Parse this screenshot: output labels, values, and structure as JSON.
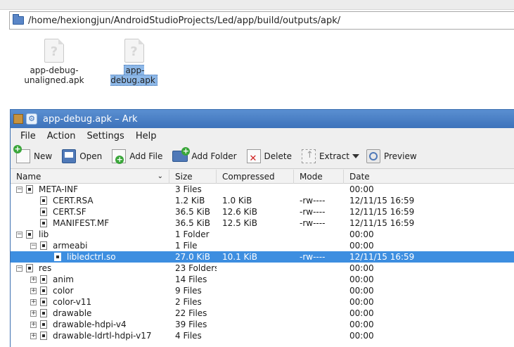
{
  "location": {
    "path": "/home/hexiongjun/AndroidStudioProjects/Led/app/build/outputs/apk/"
  },
  "files": [
    {
      "label": "app-debug-\nunaligned.apk",
      "line1": "app-debug-",
      "line2": "unaligned.apk",
      "selected": false,
      "icon": "unknown-file-icon"
    },
    {
      "label": "app-debug.apk",
      "selected": true,
      "icon": "unknown-file-icon"
    }
  ],
  "ark": {
    "title": "app-debug.apk – Ark",
    "menu": [
      "File",
      "Action",
      "Settings",
      "Help"
    ],
    "toolbar": {
      "new": "New",
      "open": "Open",
      "add_file": "Add File",
      "add_folder": "Add Folder",
      "delete": "Delete",
      "extract": "Extract",
      "preview": "Preview"
    },
    "columns": {
      "name": "Name",
      "size": "Size",
      "compressed": "Compressed",
      "mode": "Mode",
      "date": "Date"
    },
    "rows": [
      {
        "name": "META-INF",
        "size": "3 Files",
        "compressed": "",
        "mode": "",
        "date": "00:00",
        "depth": 0,
        "expander": "−",
        "selected": false
      },
      {
        "name": "CERT.RSA",
        "size": "1.2 KiB",
        "compressed": "1.0 KiB",
        "mode": "-rw----",
        "date": "12/11/15 16:59",
        "depth": 1,
        "expander": "",
        "selected": false
      },
      {
        "name": "CERT.SF",
        "size": "36.5 KiB",
        "compressed": "12.6 KiB",
        "mode": "-rw----",
        "date": "12/11/15 16:59",
        "depth": 1,
        "expander": "",
        "selected": false
      },
      {
        "name": "MANIFEST.MF",
        "size": "36.5 KiB",
        "compressed": "12.5 KiB",
        "mode": "-rw----",
        "date": "12/11/15 16:59",
        "depth": 1,
        "expander": "",
        "selected": false
      },
      {
        "name": "lib",
        "size": "1 Folder",
        "compressed": "",
        "mode": "",
        "date": "00:00",
        "depth": 0,
        "expander": "−",
        "selected": false
      },
      {
        "name": "armeabi",
        "size": "1 File",
        "compressed": "",
        "mode": "",
        "date": "00:00",
        "depth": 1,
        "expander": "−",
        "selected": false
      },
      {
        "name": "libledctrl.so",
        "size": "27.0 KiB",
        "compressed": "10.1 KiB",
        "mode": "-rw----",
        "date": "12/11/15 16:59",
        "depth": 2,
        "expander": "",
        "selected": true
      },
      {
        "name": "res",
        "size": "23 Folders",
        "compressed": "",
        "mode": "",
        "date": "00:00",
        "depth": 0,
        "expander": "−",
        "selected": false
      },
      {
        "name": "anim",
        "size": "14 Files",
        "compressed": "",
        "mode": "",
        "date": "00:00",
        "depth": 1,
        "expander": "+",
        "selected": false
      },
      {
        "name": "color",
        "size": "9 Files",
        "compressed": "",
        "mode": "",
        "date": "00:00",
        "depth": 1,
        "expander": "+",
        "selected": false
      },
      {
        "name": "color-v11",
        "size": "2 Files",
        "compressed": "",
        "mode": "",
        "date": "00:00",
        "depth": 1,
        "expander": "+",
        "selected": false
      },
      {
        "name": "drawable",
        "size": "22 Files",
        "compressed": "",
        "mode": "",
        "date": "00:00",
        "depth": 1,
        "expander": "+",
        "selected": false
      },
      {
        "name": "drawable-hdpi-v4",
        "size": "39 Files",
        "compressed": "",
        "mode": "",
        "date": "00:00",
        "depth": 1,
        "expander": "+",
        "selected": false
      },
      {
        "name": "drawable-ldrtl-hdpi-v17",
        "size": "4 Files",
        "compressed": "",
        "mode": "",
        "date": "00:00",
        "depth": 1,
        "expander": "+",
        "selected": false
      }
    ]
  },
  "colors": {
    "titlebar": "#4a80c6",
    "selection": "#3d8ee0",
    "window_bg": "#efefef"
  }
}
